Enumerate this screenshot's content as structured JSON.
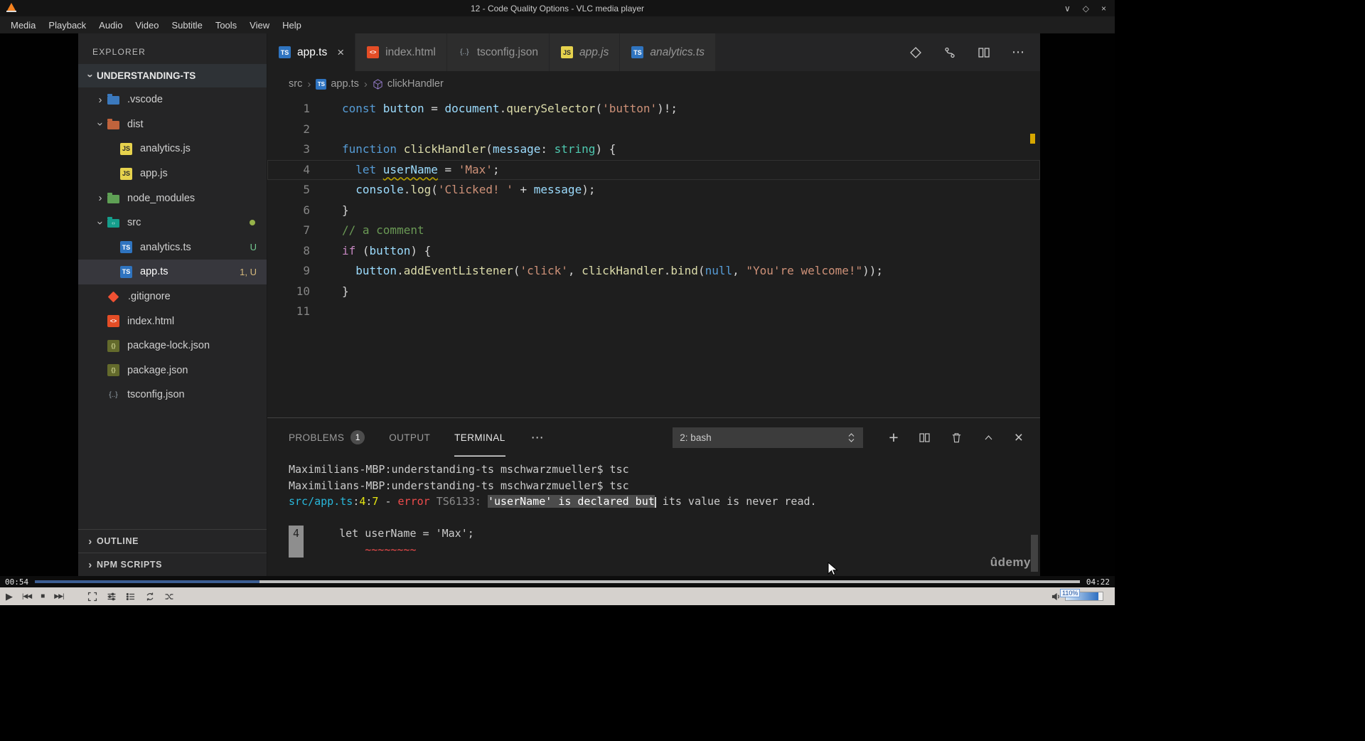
{
  "icons": {
    "minimize": "∨",
    "maximize": "◇",
    "close": "×",
    "chevron": "›",
    "more": "⋯",
    "plus": "+",
    "tab_close": "×",
    "play": "▶",
    "prev": "|◀◀",
    "stop": "■",
    "next": "▶▶|"
  },
  "vlc": {
    "title": "12 - Code Quality Options - VLC media player",
    "menu": [
      "Media",
      "Playback",
      "Audio",
      "Video",
      "Subtitle",
      "Tools",
      "View",
      "Help"
    ],
    "elapsed": "00:54",
    "total": "04:22",
    "progress_pct": 21.5,
    "volume_label": "110%",
    "volume_pct": 88
  },
  "video": {
    "watermark": "ûdemy"
  },
  "vscode": {
    "sidebar": {
      "title": "EXPLORER",
      "workspace": "UNDERSTANDING-TS",
      "tree": [
        {
          "label": ".vscode",
          "icon": "folder-vscode",
          "level": 1,
          "chevron": "right"
        },
        {
          "label": "dist",
          "icon": "folder-dist",
          "level": 1,
          "chevron": "down"
        },
        {
          "label": "analytics.js",
          "icon": "js",
          "level": 2
        },
        {
          "label": "app.js",
          "icon": "js",
          "level": 2
        },
        {
          "label": "node_modules",
          "icon": "folder-node",
          "level": 1,
          "chevron": "right"
        },
        {
          "label": "src",
          "icon": "folder-src",
          "level": 1,
          "chevron": "down",
          "dot": true
        },
        {
          "label": "analytics.ts",
          "icon": "ts",
          "level": 2,
          "badge": "U",
          "badge_color": "green"
        },
        {
          "label": "app.ts",
          "icon": "ts",
          "level": 2,
          "badge": "1, U",
          "badge_color": "gold",
          "selected": true
        },
        {
          "label": ".gitignore",
          "icon": "git",
          "level": 1
        },
        {
          "label": "index.html",
          "icon": "html",
          "level": 1
        },
        {
          "label": "package-lock.json",
          "icon": "npm",
          "level": 1
        },
        {
          "label": "package.json",
          "icon": "npm",
          "level": 1
        },
        {
          "label": "tsconfig.json",
          "icon": "braces",
          "level": 1
        }
      ],
      "sections": [
        "OUTLINE",
        "NPM SCRIPTS"
      ]
    },
    "tabs": [
      {
        "label": "app.ts",
        "icon": "ts",
        "active": true
      },
      {
        "label": "index.html",
        "icon": "html"
      },
      {
        "label": "tsconfig.json",
        "icon": "braces"
      },
      {
        "label": "app.js",
        "icon": "js",
        "italic": true
      },
      {
        "label": "analytics.ts",
        "icon": "ts",
        "italic": true
      }
    ],
    "breadcrumb": [
      {
        "label": "src"
      },
      {
        "label": "app.ts",
        "icon": "ts"
      },
      {
        "label": "clickHandler",
        "icon": "cube"
      }
    ],
    "code_lines": [
      {
        "num": 1,
        "tokens": [
          {
            "t": "const ",
            "c": "kw"
          },
          {
            "t": "button",
            "c": "var"
          },
          {
            "t": " = ",
            "c": "pl"
          },
          {
            "t": "document",
            "c": "var"
          },
          {
            "t": ".",
            "c": "pl"
          },
          {
            "t": "querySelector",
            "c": "fn"
          },
          {
            "t": "(",
            "c": "pl"
          },
          {
            "t": "'button'",
            "c": "str"
          },
          {
            "t": ")!;",
            "c": "pl"
          }
        ]
      },
      {
        "num": 2,
        "tokens": []
      },
      {
        "num": 3,
        "tokens": [
          {
            "t": "function ",
            "c": "kw"
          },
          {
            "t": "clickHandler",
            "c": "fn"
          },
          {
            "t": "(",
            "c": "pl"
          },
          {
            "t": "message",
            "c": "var"
          },
          {
            "t": ": ",
            "c": "pl"
          },
          {
            "t": "string",
            "c": "type"
          },
          {
            "t": ") {",
            "c": "pl"
          }
        ]
      },
      {
        "num": 4,
        "active": true,
        "tokens": [
          {
            "t": "  ",
            "c": "pl"
          },
          {
            "t": "let ",
            "c": "kw"
          },
          {
            "t": "userName",
            "c": "var warn"
          },
          {
            "t": " = ",
            "c": "pl"
          },
          {
            "t": "'Max'",
            "c": "str"
          },
          {
            "t": ";",
            "c": "pl"
          }
        ]
      },
      {
        "num": 5,
        "tokens": [
          {
            "t": "  ",
            "c": "pl"
          },
          {
            "t": "console",
            "c": "var"
          },
          {
            "t": ".",
            "c": "pl"
          },
          {
            "t": "log",
            "c": "fn"
          },
          {
            "t": "(",
            "c": "pl"
          },
          {
            "t": "'Clicked! '",
            "c": "str"
          },
          {
            "t": " + ",
            "c": "pl"
          },
          {
            "t": "message",
            "c": "var"
          },
          {
            "t": ");",
            "c": "pl"
          }
        ]
      },
      {
        "num": 6,
        "tokens": [
          {
            "t": "}",
            "c": "pl"
          }
        ]
      },
      {
        "num": 7,
        "tokens": [
          {
            "t": "// a comment",
            "c": "com"
          }
        ]
      },
      {
        "num": 8,
        "tokens": [
          {
            "t": "if ",
            "c": "ctrl"
          },
          {
            "t": "(",
            "c": "pl"
          },
          {
            "t": "button",
            "c": "var"
          },
          {
            "t": ") {",
            "c": "pl"
          }
        ]
      },
      {
        "num": 9,
        "tokens": [
          {
            "t": "  ",
            "c": "pl"
          },
          {
            "t": "button",
            "c": "var"
          },
          {
            "t": ".",
            "c": "pl"
          },
          {
            "t": "addEventListener",
            "c": "fn"
          },
          {
            "t": "(",
            "c": "pl"
          },
          {
            "t": "'click'",
            "c": "str"
          },
          {
            "t": ", ",
            "c": "pl"
          },
          {
            "t": "clickHandler",
            "c": "fn"
          },
          {
            "t": ".",
            "c": "pl"
          },
          {
            "t": "bind",
            "c": "fn"
          },
          {
            "t": "(",
            "c": "pl"
          },
          {
            "t": "null",
            "c": "kw"
          },
          {
            "t": ", ",
            "c": "pl"
          },
          {
            "t": "\"You're welcome!\"",
            "c": "str"
          },
          {
            "t": "));",
            "c": "pl"
          }
        ]
      },
      {
        "num": 10,
        "tokens": [
          {
            "t": "}",
            "c": "pl"
          }
        ]
      },
      {
        "num": 11,
        "tokens": []
      }
    ],
    "panel": {
      "tabs": [
        {
          "label": "PROBLEMS",
          "badge": "1"
        },
        {
          "label": "OUTPUT"
        },
        {
          "label": "TERMINAL",
          "active": true
        }
      ],
      "shell": "2: bash",
      "terminal": [
        {
          "tokens": [
            {
              "t": "Maximilians-MBP:understanding-ts mschwarzmueller$ tsc",
              "c": "pl"
            }
          ]
        },
        {
          "tokens": [
            {
              "t": "Maximilians-MBP:understanding-ts mschwarzmueller$ tsc",
              "c": "pl"
            }
          ]
        },
        {
          "tokens": [
            {
              "t": "src/app.ts",
              "c": "cyan"
            },
            {
              "t": ":",
              "c": "pl"
            },
            {
              "t": "4",
              "c": "yel"
            },
            {
              "t": ":",
              "c": "pl"
            },
            {
              "t": "7",
              "c": "yel"
            },
            {
              "t": " - ",
              "c": "pl"
            },
            {
              "t": "error",
              "c": "red"
            },
            {
              "t": " ",
              "c": "pl"
            },
            {
              "t": "TS6133: ",
              "c": "dim"
            },
            {
              "t": "'userName' is declared but",
              "c": "sel"
            },
            {
              "t": "",
              "c": "cursor"
            },
            {
              "t": " its value is never read.",
              "c": "pl"
            }
          ]
        },
        {
          "tokens": []
        },
        {
          "gutter": "4",
          "tokens": [
            {
              "t": "   let userName = 'Max';",
              "c": "pl"
            }
          ]
        },
        {
          "gutter": " ",
          "tokens": [
            {
              "t": "       ",
              "c": "pl"
            },
            {
              "t": "~~~~~~~~",
              "c": "red"
            }
          ]
        }
      ]
    }
  }
}
